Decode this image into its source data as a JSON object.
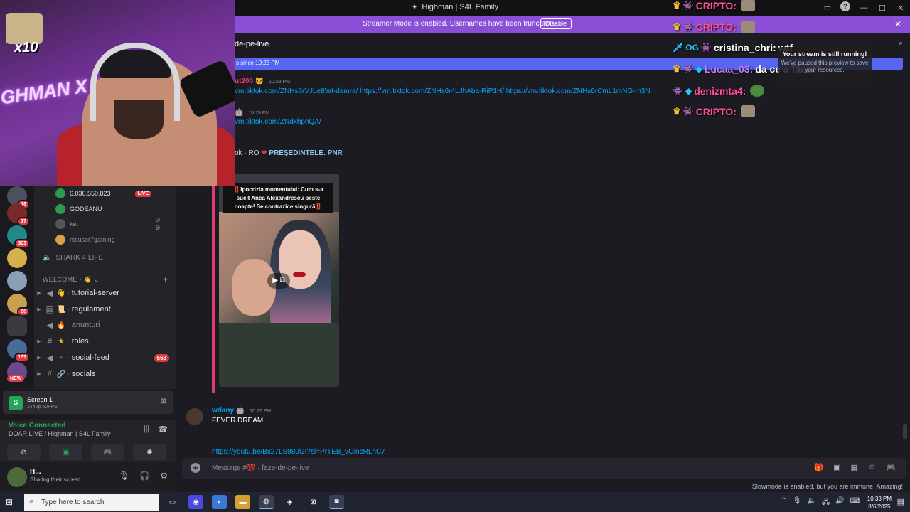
{
  "window": {
    "title": "Highman | S4L Family"
  },
  "banner": {
    "message": "Streamer Mode is enabled. Usernames have been truncated.",
    "disable_label": "Disable"
  },
  "rail": {
    "badges": [
      "18",
      "17",
      "303",
      "88",
      "137"
    ],
    "new_label": "NEW"
  },
  "voice_users": [
    {
      "name": "6.036.550.823",
      "live": "LIVE"
    },
    {
      "name": "GODEANU"
    },
    {
      "name": "ket"
    },
    {
      "name": "nicusor7gaming"
    }
  ],
  "shark_channel": "SHARK 4 LIFE",
  "category": "WELCOME -",
  "channels": [
    {
      "name": "tutorial-server",
      "emoji": "👋",
      "type": "#",
      "arrow": "▶",
      "dim": false
    },
    {
      "name": "regulament",
      "emoji": "📜",
      "type": "▤",
      "arrow": "▶",
      "dim": false
    },
    {
      "name": "anunturi",
      "emoji": "🔥",
      "type": "◀",
      "arrow": "",
      "dim": true
    },
    {
      "name": "roles",
      "emoji": "★",
      "type": "#",
      "arrow": "▶",
      "dim": false
    },
    {
      "name": "social-feed",
      "emoji": "▪",
      "type": "◀",
      "arrow": "▶",
      "dim": false,
      "count": "563"
    },
    {
      "name": "socials",
      "emoji": "🔗",
      "type": "#",
      "arrow": "▶",
      "dim": false
    }
  ],
  "screenshare": {
    "title": "Screen 1",
    "subtitle": "1440p 60FPS"
  },
  "voice": {
    "status": "Voice Connected",
    "channel": "DOAR LIVE / Highman | S4L Family"
  },
  "user": {
    "name": "H...",
    "status": "Sharing their screen"
  },
  "chat": {
    "channel_name": "de-pe-live",
    "unread_text": "s since 10:23 PM",
    "msg1_user": "ut200",
    "msg1_time": "10:23 PM",
    "msg1_links": "vm.tiktok.com/ZNHs6rVJLe8Wt-damra/ https://vm.tiktok.com/ZNHs6r4LJhAba-RiP1H/ https://vm.tiktok.com/ZNHs6rCmL1mNG-m3N",
    "msg2_time": "10:25 PM",
    "msg2_link": "vm.tiktok.com/ZNdxhpnQA/",
    "embed_author": "ok · RO",
    "embed_title": "PREȘEDINTELE. PNR",
    "embed_caption": "‼️Ipocrizia momentului: Cum s-a sucit Anca Alexandrescu peste noapte! Se contrazice singură‼️",
    "msg3_user": "wdany",
    "msg3_time": "10:27 PM",
    "msg3_text": "FEVER DREAM",
    "msg4_link": "https://youtu.be/Bx27LS980GI?si=PrTEB_vOlncRLhC7",
    "composer_placeholder": "Message #💯 · faze-de-pe-live",
    "slowmode": "Slowmode is enabled, but you are immune. Amazing!"
  },
  "overlay_chat": [
    {
      "user": "CRIPTO:",
      "text": "",
      "color": "#ff4e9b"
    },
    {
      "user": "CRIPTO:",
      "text": "",
      "color": "#ff4e9b"
    },
    {
      "user": "cristina_chri:",
      "text": "wtf",
      "color": "#ffffff"
    },
    {
      "user": "Lucaa_03:",
      "text": "da ce a făcut?",
      "color": "#c07cff"
    },
    {
      "user": "denizmta4:",
      "text": "",
      "color": "#ff4e9b"
    },
    {
      "user": "CRIPTO:",
      "text": "",
      "color": "#ff4e9b"
    }
  ],
  "stream_toast": {
    "title": "Your stream is still running!",
    "body": "We've paused this preview to save your resources."
  },
  "webcam": {
    "multiplier": "x10",
    "neon_text": "GHMAN X KICK"
  },
  "taskbar": {
    "search_placeholder": "Type here to search",
    "time": "10:33 PM",
    "date": "8/6/2025"
  },
  "colors": {
    "banner": "#8a4fd6",
    "accent": "#5865f2",
    "live": "#e03b45",
    "voice_green": "#23a55a",
    "link": "#00a8fc"
  }
}
